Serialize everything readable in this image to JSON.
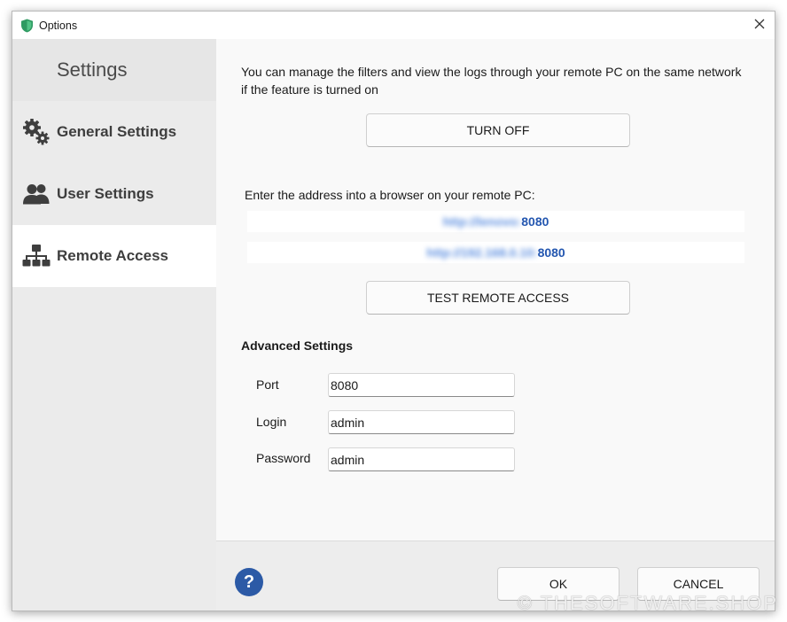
{
  "window": {
    "title": "Options",
    "app_icon": "shield-icon",
    "close_glyph": "✕"
  },
  "sidebar": {
    "heading": "Settings",
    "items": [
      {
        "label": "General Settings",
        "icon": "gears-icon",
        "active": false
      },
      {
        "label": "User Settings",
        "icon": "users-icon",
        "active": false
      },
      {
        "label": "Remote Access",
        "icon": "network-icon",
        "active": true
      }
    ]
  },
  "remote": {
    "intro": "You can manage the filters and view the logs through your remote PC on the same network if the feature is turned on",
    "toggle_button": "TURN OFF",
    "address_label": "Enter the address into a browser on your remote PC:",
    "addresses": [
      {
        "hidden": "http://lenovo:",
        "port": "8080"
      },
      {
        "hidden": "http://192.168.0.10:",
        "port": "8080"
      }
    ],
    "test_button": "TEST REMOTE ACCESS"
  },
  "advanced": {
    "title": "Advanced Settings",
    "port_label": "Port",
    "port_value": "8080",
    "login_label": "Login",
    "login_value": "admin",
    "password_label": "Password",
    "password_value": "admin"
  },
  "footer": {
    "help": "?",
    "ok": "OK",
    "cancel": "CANCEL"
  },
  "watermark": "© THESOFTWARE.SHOP",
  "colors": {
    "accent": "#2c5aa6",
    "link": "#2457b0",
    "sidebar_bg": "#ebebeb",
    "active_item_bg": "#ffffff"
  }
}
